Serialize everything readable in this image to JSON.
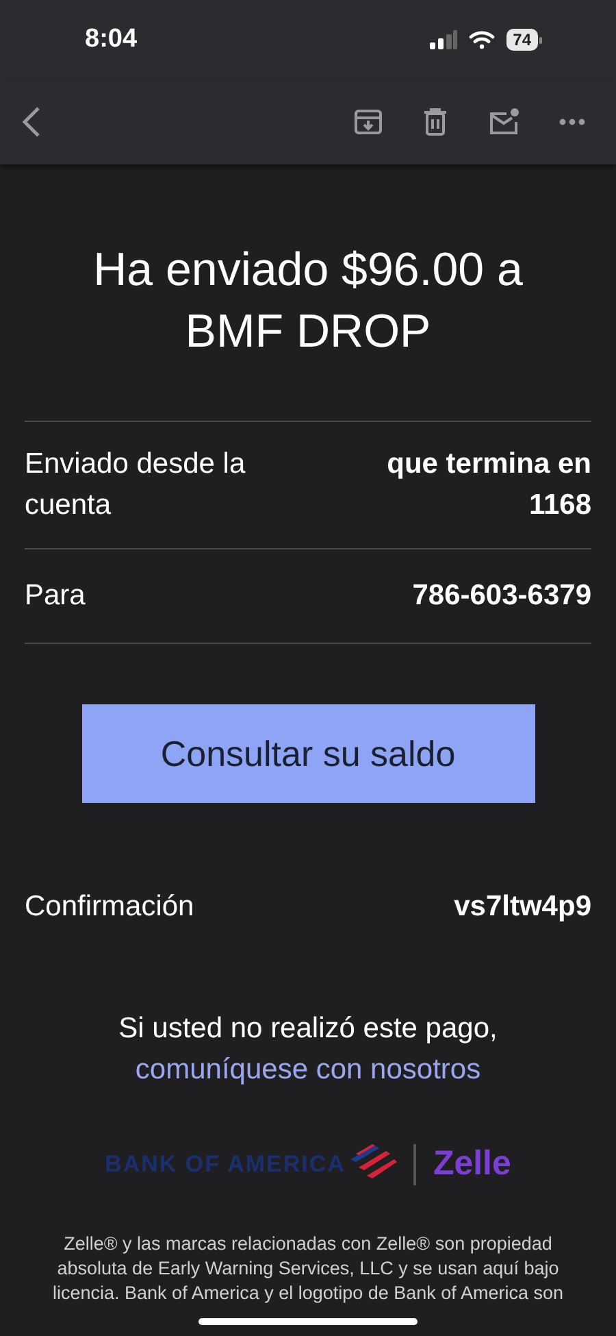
{
  "status_bar": {
    "time": "8:04",
    "battery": "74"
  },
  "title": "Ha enviado $96.00 a BMF DROP",
  "details": [
    {
      "label": "Enviado desde la cuenta",
      "value": "que termina en 1168"
    },
    {
      "label": "Para",
      "value": "786-603-6379"
    }
  ],
  "button": "Consultar su saldo",
  "confirmation": {
    "label": "Confirmación",
    "value": "vs7ltw4p9"
  },
  "notice": {
    "text": "Si usted no realizó este pago,",
    "link": "comuníquese con nosotros"
  },
  "logos": {
    "bank": "BANK OF AMERICA",
    "zelle": "Zelle"
  },
  "footer": "Zelle® y las marcas relacionadas con Zelle® son propiedad absoluta de Early Warning Services, LLC y se usan aquí bajo licencia. Bank of America y el logotipo de Bank of America son"
}
